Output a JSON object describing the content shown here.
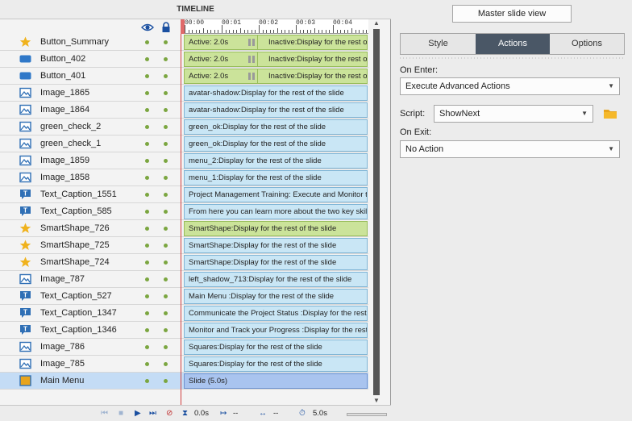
{
  "timeline": {
    "title": "TIMELINE",
    "ruler": [
      "00:00",
      "00:01",
      "00:02",
      "00:03",
      "00:04"
    ],
    "rows": [
      {
        "name": "Button_Summary",
        "icon": "star-icon",
        "bar": "Active: 2.0s",
        "bar2": "Inactive:Display for the rest of the slide",
        "style": "green"
      },
      {
        "name": "Button_402",
        "icon": "button-icon",
        "bar": "Active: 2.0s",
        "bar2": "Inactive:Display for the rest of the slide",
        "style": "green"
      },
      {
        "name": "Button_401",
        "icon": "button-icon",
        "bar": "Active: 2.0s",
        "bar2": "Inactive:Display for the rest of the slide",
        "style": "green"
      },
      {
        "name": "Image_1865",
        "icon": "image-icon",
        "bar": "avatar-shadow:Display for the rest of the slide",
        "style": "blue"
      },
      {
        "name": "Image_1864",
        "icon": "image-icon",
        "bar": "avatar-shadow:Display for the rest of the slide",
        "style": "blue"
      },
      {
        "name": "green_check_2",
        "icon": "image-icon",
        "bar": "green_ok:Display for the rest of the slide",
        "style": "blue"
      },
      {
        "name": "green_check_1",
        "icon": "image-icon",
        "bar": "green_ok:Display for the rest of the slide",
        "style": "blue"
      },
      {
        "name": "Image_1859",
        "icon": "image-icon",
        "bar": "menu_2:Display for the rest of the slide",
        "style": "blue"
      },
      {
        "name": "Image_1858",
        "icon": "image-icon",
        "bar": "menu_1:Display for the rest of the slide",
        "style": "blue"
      },
      {
        "name": "Text_Caption_1551",
        "icon": "text-caption-icon",
        "bar": "Project Management Training: Execute and Monitor the Project",
        "style": "blue"
      },
      {
        "name": "Text_Caption_585",
        "icon": "text-caption-icon",
        "bar": "From here you can learn more about the two key skills",
        "style": "blue"
      },
      {
        "name": "SmartShape_726",
        "icon": "star-icon",
        "bar": "SmartShape:Display for the rest of the slide",
        "style": "green"
      },
      {
        "name": "SmartShape_725",
        "icon": "star-icon",
        "bar": "SmartShape:Display for the rest of the slide",
        "style": "blue"
      },
      {
        "name": "SmartShape_724",
        "icon": "star-icon",
        "bar": "SmartShape:Display for the rest of the slide",
        "style": "blue"
      },
      {
        "name": "Image_787",
        "icon": "image-icon",
        "bar": "left_shadow_713:Display for the rest of the slide",
        "style": "blue"
      },
      {
        "name": "Text_Caption_527",
        "icon": "text-caption-icon",
        "bar": "Main Menu :Display for the rest of the slide",
        "style": "blue"
      },
      {
        "name": "Text_Caption_1347",
        "icon": "text-caption-icon",
        "bar": "Communicate the Project Status :Display for the rest of the slide",
        "style": "blue"
      },
      {
        "name": "Text_Caption_1346",
        "icon": "text-caption-icon",
        "bar": "Monitor and Track your Progress :Display for the rest of the slide",
        "style": "blue"
      },
      {
        "name": "Image_786",
        "icon": "image-icon",
        "bar": "Squares:Display for the rest of the slide",
        "style": "blue"
      },
      {
        "name": "Image_785",
        "icon": "image-icon",
        "bar": "Squares:Display for the rest of the slide",
        "style": "blue"
      },
      {
        "name": "Main Menu",
        "icon": "slide-icon",
        "bar": "Slide (5.0s)",
        "style": "slide",
        "selected": true
      }
    ],
    "controls": {
      "current_time": "0.0s",
      "start": "--",
      "duration": "--",
      "total": "5.0s"
    }
  },
  "props": {
    "master_slide_view": "Master slide view",
    "tabs": [
      "Style",
      "Actions",
      "Options"
    ],
    "active_tab": "Actions",
    "on_enter_label": "On Enter:",
    "on_enter_value": "Execute Advanced Actions",
    "script_label": "Script:",
    "script_value": "ShowNext",
    "on_exit_label": "On Exit:",
    "on_exit_value": "No Action"
  },
  "colors": {
    "active_tab": "#4a5766",
    "green_bar": "#cbe39a",
    "blue_bar": "#c9e6f5",
    "slide_bar": "#a9c4ef",
    "playhead": "#d04040"
  }
}
